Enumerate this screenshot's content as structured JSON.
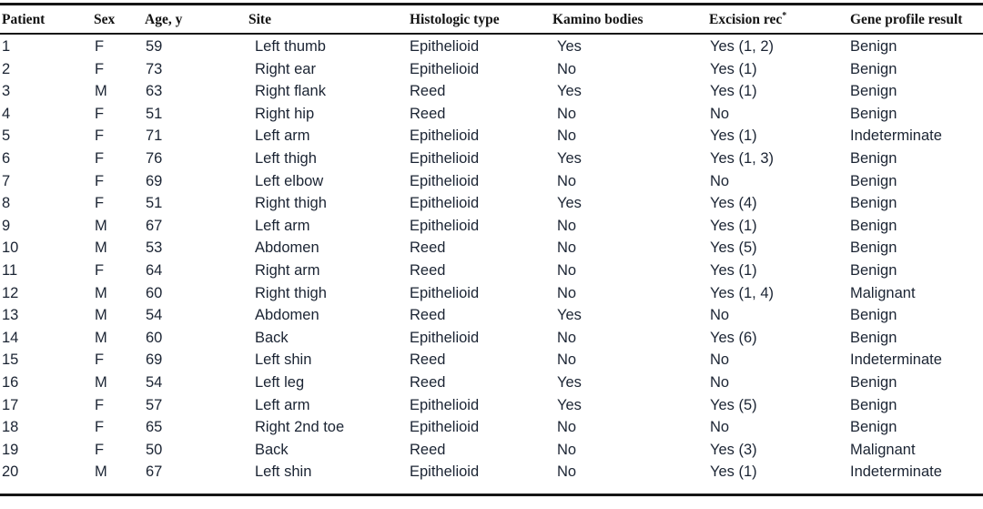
{
  "table": {
    "columns": [
      {
        "key": "patient",
        "label": "Patient",
        "footnote": ""
      },
      {
        "key": "sex",
        "label": "Sex",
        "footnote": ""
      },
      {
        "key": "age",
        "label": "Age, y",
        "footnote": ""
      },
      {
        "key": "site",
        "label": "Site",
        "footnote": ""
      },
      {
        "key": "histo",
        "label": "Histologic type",
        "footnote": ""
      },
      {
        "key": "kamino",
        "label": "Kamino bodies",
        "footnote": ""
      },
      {
        "key": "excision",
        "label": "Excision rec",
        "footnote": "*"
      },
      {
        "key": "gene",
        "label": "Gene profile result",
        "footnote": ""
      }
    ],
    "rows": [
      {
        "patient": "1",
        "sex": "F",
        "age": "59",
        "site": "Left thumb",
        "histo": "Epithelioid",
        "kamino": "Yes",
        "excision": "Yes (1, 2)",
        "gene": "Benign"
      },
      {
        "patient": "2",
        "sex": "F",
        "age": "73",
        "site": "Right ear",
        "histo": "Epithelioid",
        "kamino": "No",
        "excision": "Yes (1)",
        "gene": "Benign"
      },
      {
        "patient": "3",
        "sex": "M",
        "age": "63",
        "site": "Right flank",
        "histo": "Reed",
        "kamino": "Yes",
        "excision": "Yes (1)",
        "gene": "Benign"
      },
      {
        "patient": "4",
        "sex": "F",
        "age": "51",
        "site": "Right hip",
        "histo": "Reed",
        "kamino": "No",
        "excision": "No",
        "gene": "Benign"
      },
      {
        "patient": "5",
        "sex": "F",
        "age": "71",
        "site": "Left arm",
        "histo": "Epithelioid",
        "kamino": "No",
        "excision": "Yes (1)",
        "gene": "Indeterminate"
      },
      {
        "patient": "6",
        "sex": "F",
        "age": "76",
        "site": "Left thigh",
        "histo": "Epithelioid",
        "kamino": "Yes",
        "excision": "Yes (1, 3)",
        "gene": "Benign"
      },
      {
        "patient": "7",
        "sex": "F",
        "age": "69",
        "site": "Left elbow",
        "histo": "Epithelioid",
        "kamino": "No",
        "excision": "No",
        "gene": "Benign"
      },
      {
        "patient": "8",
        "sex": "F",
        "age": "51",
        "site": "Right thigh",
        "histo": "Epithelioid",
        "kamino": "Yes",
        "excision": "Yes (4)",
        "gene": "Benign"
      },
      {
        "patient": "9",
        "sex": "M",
        "age": "67",
        "site": "Left arm",
        "histo": "Epithelioid",
        "kamino": "No",
        "excision": "Yes (1)",
        "gene": "Benign"
      },
      {
        "patient": "10",
        "sex": "M",
        "age": "53",
        "site": "Abdomen",
        "histo": "Reed",
        "kamino": "No",
        "excision": "Yes (5)",
        "gene": "Benign"
      },
      {
        "patient": "11",
        "sex": "F",
        "age": "64",
        "site": "Right arm",
        "histo": "Reed",
        "kamino": "No",
        "excision": "Yes (1)",
        "gene": "Benign"
      },
      {
        "patient": "12",
        "sex": "M",
        "age": "60",
        "site": "Right thigh",
        "histo": "Epithelioid",
        "kamino": "No",
        "excision": "Yes (1, 4)",
        "gene": "Malignant"
      },
      {
        "patient": "13",
        "sex": "M",
        "age": "54",
        "site": "Abdomen",
        "histo": "Reed",
        "kamino": "Yes",
        "excision": "No",
        "gene": "Benign"
      },
      {
        "patient": "14",
        "sex": "M",
        "age": "60",
        "site": "Back",
        "histo": "Epithelioid",
        "kamino": "No",
        "excision": "Yes (6)",
        "gene": "Benign"
      },
      {
        "patient": "15",
        "sex": "F",
        "age": "69",
        "site": "Left shin",
        "histo": "Reed",
        "kamino": "No",
        "excision": "No",
        "gene": "Indeterminate"
      },
      {
        "patient": "16",
        "sex": "M",
        "age": "54",
        "site": "Left leg",
        "histo": "Reed",
        "kamino": "Yes",
        "excision": "No",
        "gene": "Benign"
      },
      {
        "patient": "17",
        "sex": "F",
        "age": "57",
        "site": "Left arm",
        "histo": "Epithelioid",
        "kamino": "Yes",
        "excision": "Yes (5)",
        "gene": "Benign"
      },
      {
        "patient": "18",
        "sex": "F",
        "age": "65",
        "site": "Right 2nd toe",
        "histo": "Epithelioid",
        "kamino": "No",
        "excision": "No",
        "gene": "Benign"
      },
      {
        "patient": "19",
        "sex": "F",
        "age": "50",
        "site": "Back",
        "histo": "Reed",
        "kamino": "No",
        "excision": "Yes (3)",
        "gene": "Malignant"
      },
      {
        "patient": "20",
        "sex": "M",
        "age": "67",
        "site": "Left shin",
        "histo": "Epithelioid",
        "kamino": "No",
        "excision": "Yes (1)",
        "gene": "Indeterminate"
      }
    ]
  },
  "colors": {
    "rule": "#151515",
    "header_text": "#121212",
    "body_text": "#1b2433"
  }
}
